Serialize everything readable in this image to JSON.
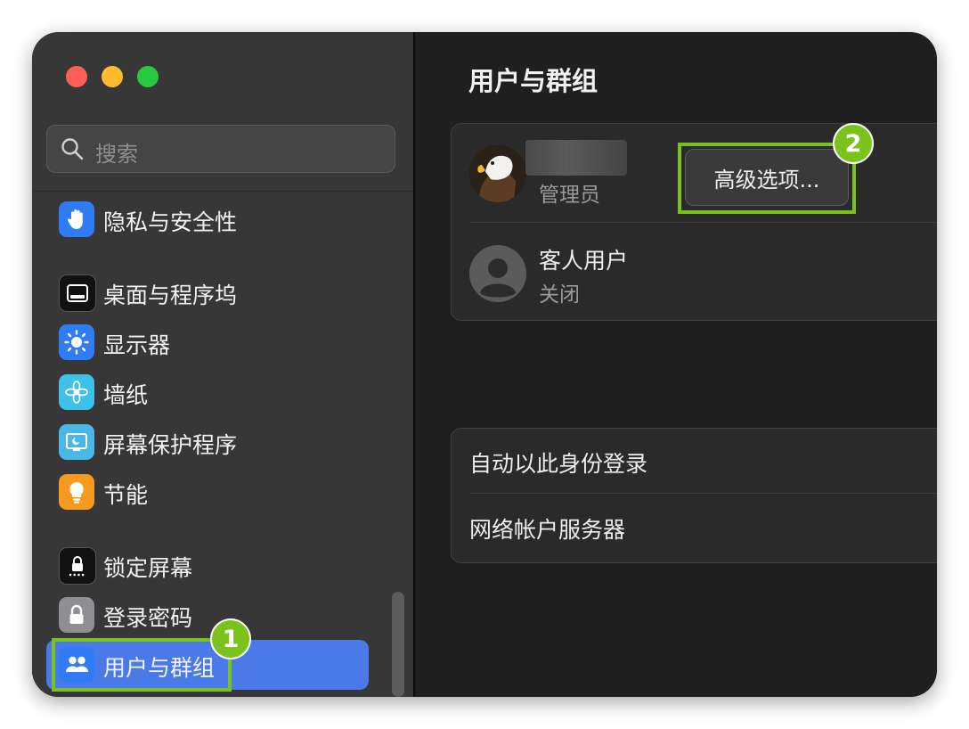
{
  "sidebar": {
    "search_placeholder": "搜索",
    "items": [
      {
        "label": "隐私与安全性",
        "icon": "hand-icon"
      },
      {
        "label": "桌面与程序坞",
        "icon": "dock-icon"
      },
      {
        "label": "显示器",
        "icon": "sun-icon"
      },
      {
        "label": "墙纸",
        "icon": "flower-icon"
      },
      {
        "label": "屏幕保护程序",
        "icon": "screensaver-icon"
      },
      {
        "label": "节能",
        "icon": "lightbulb-icon"
      },
      {
        "label": "锁定屏幕",
        "icon": "lock-screen-icon"
      },
      {
        "label": "登录密码",
        "icon": "lock-icon"
      },
      {
        "label": "用户与群组",
        "icon": "users-icon",
        "selected": true
      }
    ]
  },
  "main": {
    "title": "用户与群组",
    "users": [
      {
        "name": "",
        "role": "管理员",
        "avatar": "eagle-avatar"
      },
      {
        "name": "客人用户",
        "role": "关闭",
        "avatar": "person-avatar"
      }
    ],
    "advanced_button_label": "高级选项...",
    "options": [
      "自动以此身份登录",
      "网络帐户服务器"
    ]
  },
  "annotations": {
    "badge1": "1",
    "badge2": "2",
    "color": "#7cc21c"
  },
  "colors": {
    "selected_bg": "#4a79e8",
    "sidebar_bg": "#373737",
    "main_bg": "#1f1f1f"
  }
}
